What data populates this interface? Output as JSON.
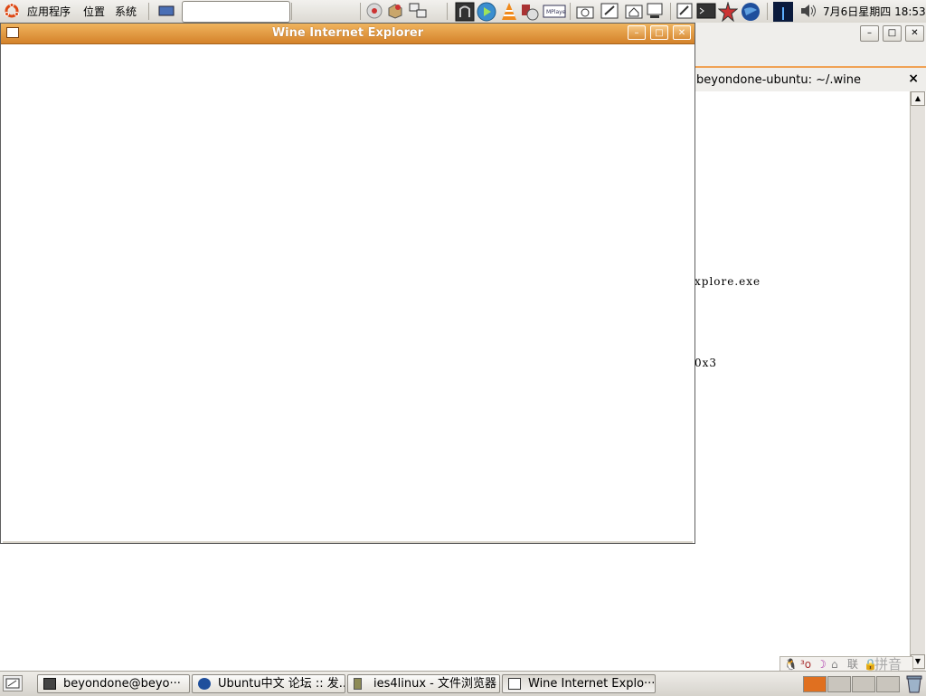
{
  "top_panel": {
    "menus": [
      "应用程序",
      "位置",
      "系统"
    ],
    "clock": "7月6日星期四 18:53",
    "search_value": ""
  },
  "terminal": {
    "tab_title": "beyondone-ubuntu: ~/.wine",
    "close": "×",
    "line1": "xplore.exe",
    "line2": "0x3"
  },
  "ie_window": {
    "title": "Wine Internet Explorer"
  },
  "ime": {
    "labels": [
      "联",
      "拼音"
    ]
  },
  "taskbar": {
    "items": [
      {
        "label": "beyondone@beyo···"
      },
      {
        "label": "Ubuntu中文 论坛 :: 发..."
      },
      {
        "label": "ies4linux - 文件浏览器"
      },
      {
        "label": "Wine Internet Explo···"
      }
    ]
  },
  "colors": {
    "titlebar_active": "#d4822a",
    "tab_accent": "#f0a255"
  }
}
